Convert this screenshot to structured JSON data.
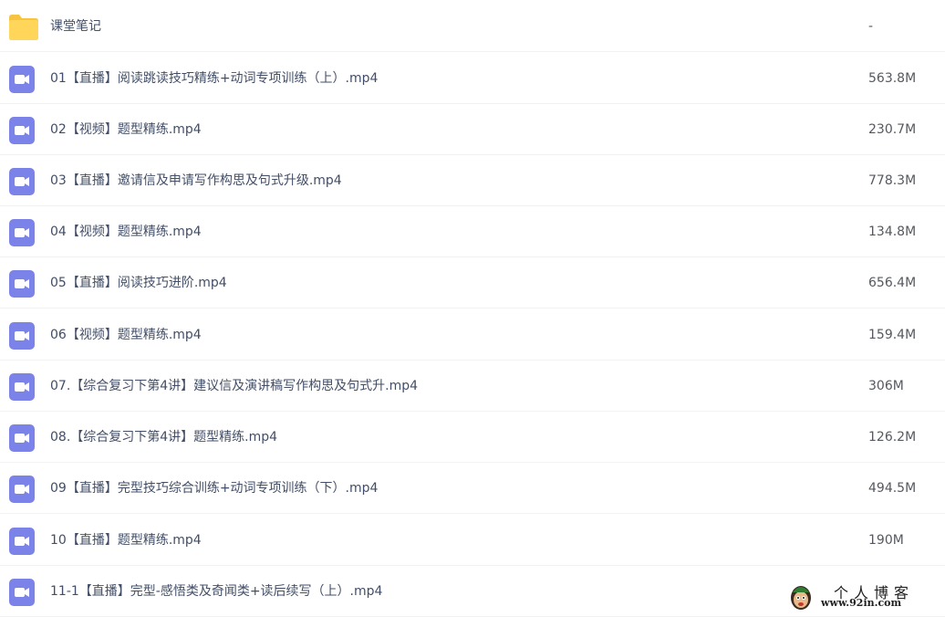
{
  "files": [
    {
      "name": "课堂笔记",
      "size": "-",
      "type": "folder"
    },
    {
      "name": "01【直播】阅读跳读技巧精练+动词专项训练（上）.mp4",
      "size": "563.8M",
      "type": "video"
    },
    {
      "name": "02【视频】题型精练.mp4",
      "size": "230.7M",
      "type": "video"
    },
    {
      "name": "03【直播】邀请信及申请写作构思及句式升级.mp4",
      "size": "778.3M",
      "type": "video"
    },
    {
      "name": "04【视频】题型精练.mp4",
      "size": "134.8M",
      "type": "video"
    },
    {
      "name": "05【直播】阅读技巧进阶.mp4",
      "size": "656.4M",
      "type": "video"
    },
    {
      "name": "06【视频】题型精练.mp4",
      "size": "159.4M",
      "type": "video"
    },
    {
      "name": "07.【综合复习下第4讲】建议信及演讲稿写作构思及句式升.mp4",
      "size": "306M",
      "type": "video"
    },
    {
      "name": "08.【综合复习下第4讲】题型精练.mp4",
      "size": "126.2M",
      "type": "video"
    },
    {
      "name": "09【直播】完型技巧综合训练+动词专项训练（下）.mp4",
      "size": "494.5M",
      "type": "video"
    },
    {
      "name": "10【直播】题型精练.mp4",
      "size": "190M",
      "type": "video"
    },
    {
      "name": "11-1【直播】完型-感悟类及奇闻类+读后续写（上）.mp4",
      "size": "",
      "type": "video"
    }
  ],
  "icons": {
    "folder": "folder-icon",
    "video": "video-file-icon"
  },
  "colors": {
    "folder": "#ffd659",
    "folder_tab": "#f6c342",
    "video": "#7b82e8",
    "text": "#424e67",
    "size_text": "#55595f",
    "divider": "#f1f2f4"
  },
  "watermark": {
    "title": "个人博客",
    "url": "www.92in.com"
  }
}
